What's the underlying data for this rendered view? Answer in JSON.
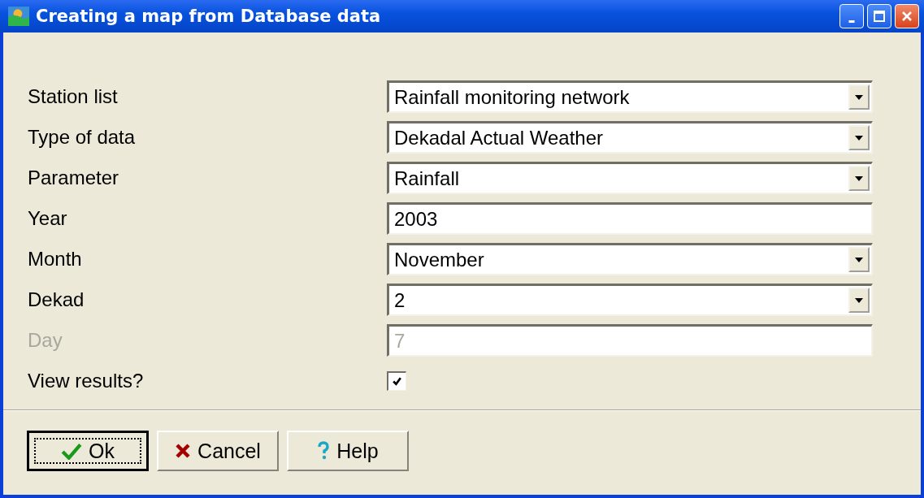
{
  "window": {
    "title": "Creating a map from Database data"
  },
  "fields": [
    {
      "label": "Station list",
      "kind": "dropdown",
      "value": "Rainfall monitoring network",
      "disabled": false
    },
    {
      "label": "Type of data",
      "kind": "dropdown",
      "value": "Dekadal Actual Weather",
      "disabled": false
    },
    {
      "label": "Parameter",
      "kind": "dropdown",
      "value": "Rainfall",
      "disabled": false
    },
    {
      "label": "Year",
      "kind": "text",
      "value": "2003",
      "disabled": false
    },
    {
      "label": "Month",
      "kind": "dropdown",
      "value": "November",
      "disabled": false
    },
    {
      "label": "Dekad",
      "kind": "dropdown",
      "value": "2",
      "disabled": false
    },
    {
      "label": "Day",
      "kind": "text",
      "value": "7",
      "disabled": true
    },
    {
      "label": "View results?",
      "kind": "checkbox",
      "checked": true,
      "disabled": false
    }
  ],
  "buttons": [
    {
      "label": "Ok",
      "focused": true
    },
    {
      "label": "Cancel",
      "focused": false
    },
    {
      "label": "Help",
      "focused": false
    }
  ]
}
